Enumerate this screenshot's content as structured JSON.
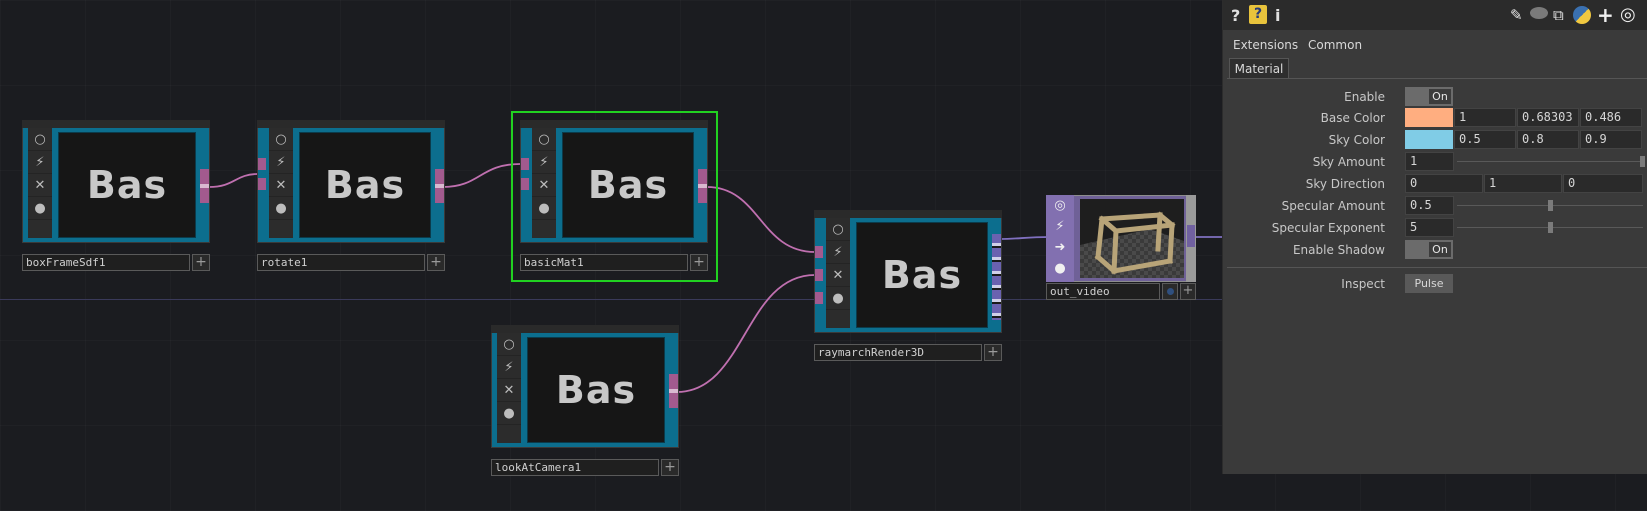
{
  "network": {
    "nodes": [
      {
        "id": "boxFrameSdf1",
        "preview_text": "Bas"
      },
      {
        "id": "rotate1",
        "preview_text": "Bas"
      },
      {
        "id": "basicMat1",
        "preview_text": "Bas",
        "selected": true
      },
      {
        "id": "lookAtCamera1",
        "preview_text": "Bas"
      },
      {
        "id": "raymarchRender3D",
        "preview_text": "Bas"
      }
    ],
    "video_node": {
      "label": "out_video"
    },
    "wire_color": "#c070b0",
    "selection_color": "#21d121"
  },
  "toolbar": {
    "help_icon": "?",
    "info_icon": "i",
    "icons": [
      "edit-icon",
      "comment-icon",
      "clone-icon",
      "python-icon",
      "plus-icon",
      "target-icon"
    ]
  },
  "tabs": [
    "Extensions",
    "Common"
  ],
  "page_tab": "Material",
  "params": {
    "enable": {
      "label": "Enable",
      "value": "On"
    },
    "base_color": {
      "label": "Base Color",
      "color": "#ffae80",
      "r": "1",
      "g": "0.68303",
      "b": "0.486"
    },
    "sky_color": {
      "label": "Sky Color",
      "color": "#80cce6",
      "r": "0.5",
      "g": "0.8",
      "b": "0.9"
    },
    "sky_amount": {
      "label": "Sky Amount",
      "value": "1"
    },
    "sky_direction": {
      "label": "Sky Direction",
      "x": "0",
      "y": "1",
      "z": "0"
    },
    "specular_amount": {
      "label": "Specular Amount",
      "value": "0.5"
    },
    "specular_exponent": {
      "label": "Specular Exponent",
      "value": "5"
    },
    "enable_shadow": {
      "label": "Enable Shadow",
      "value": "On"
    },
    "inspect": {
      "label": "Inspect",
      "button": "Pulse"
    }
  }
}
